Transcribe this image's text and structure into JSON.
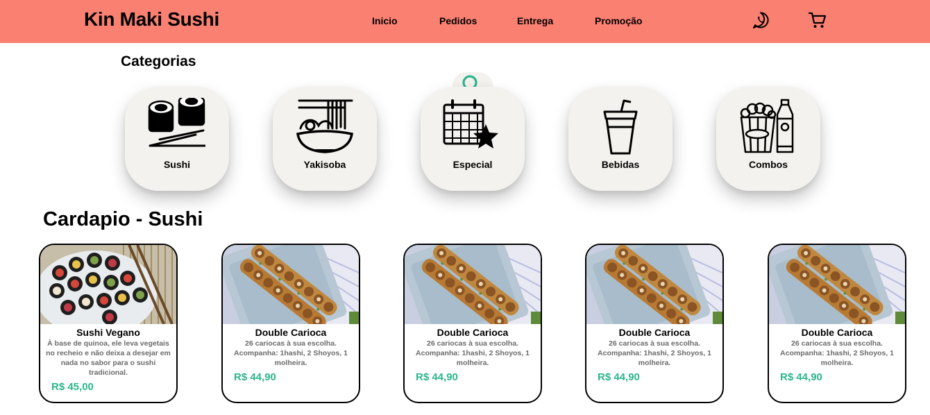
{
  "header": {
    "brand": "Kin Maki Sushi",
    "nav": [
      "Inicio",
      "Pedidos",
      "Entrega",
      "Promoção"
    ],
    "icons": [
      "whatsapp-icon",
      "cart-icon"
    ],
    "background_color": "#fa8072"
  },
  "categories": {
    "title": "Categorias",
    "items": [
      {
        "label": "Sushi",
        "icon": "sushi-icon"
      },
      {
        "label": "Yakisoba",
        "icon": "noodle-bowl-icon"
      },
      {
        "label": "Especial",
        "icon": "calendar-star-icon"
      },
      {
        "label": "Bebidas",
        "icon": "drink-cup-icon"
      },
      {
        "label": "Combos",
        "icon": "popcorn-bottle-icon"
      }
    ],
    "search_icon": "search-icon",
    "search_color": "#2bb58c"
  },
  "menu": {
    "title": "Cardapio - Sushi",
    "price_color": "#2bb58c",
    "items": [
      {
        "name": "Sushi Vegano",
        "description": "À base de quinoa, ele leva vegetais no recheio e não deixa a desejar em nada no sabor para o sushi tradicional.",
        "price": "R$ 45,00"
      },
      {
        "name": "Double Carioca",
        "description": "26 cariocas à sua escolha. Acompanha: 1hashi, 2 Shoyos, 1 molheira.",
        "price": "R$ 44,90"
      },
      {
        "name": "Double Carioca",
        "description": "26 cariocas à sua escolha. Acompanha: 1hashi, 2 Shoyos, 1 molheira.",
        "price": "R$ 44,90"
      },
      {
        "name": "Double Carioca",
        "description": "26 cariocas à sua escolha. Acompanha: 1hashi, 2 Shoyos, 1 molheira.",
        "price": "R$ 44,90"
      },
      {
        "name": "Double Carioca",
        "description": "26 cariocas à sua escolha. Acompanha: 1hashi, 2 Shoyos, 1 molheira.",
        "price": "R$ 44,90"
      }
    ]
  }
}
